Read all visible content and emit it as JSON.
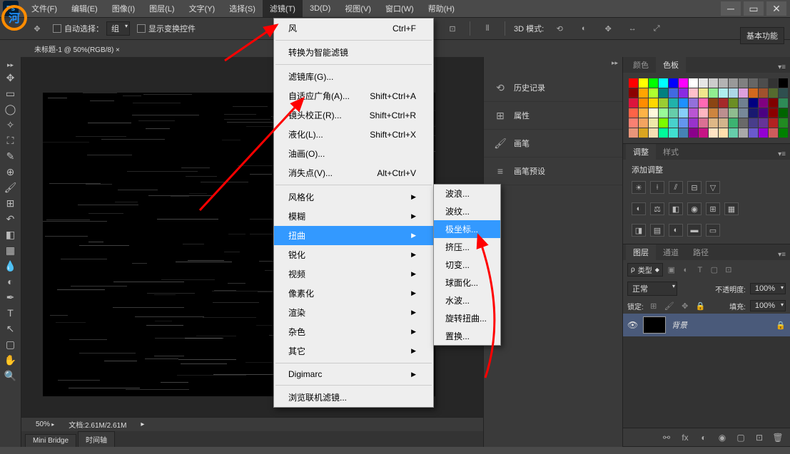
{
  "menubar": [
    "文件(F)",
    "编辑(E)",
    "图像(I)",
    "图层(L)",
    "文字(Y)",
    "选择(S)",
    "滤镜(T)",
    "3D(D)",
    "视图(V)",
    "窗口(W)",
    "帮助(H)"
  ],
  "optionbar": {
    "auto_select": "自动选择：",
    "auto_select_value": "组",
    "show_transform": "显示变换控件",
    "mode_3d": "3D 模式:"
  },
  "top_right_button": "基本功能",
  "doc_tab": "未标题-1 @ 50%(RGB/8) ×",
  "status": {
    "zoom": "50%",
    "doc": "文档:2.61M/2.61M"
  },
  "bottom_tabs": [
    "Mini Bridge",
    "时间轴"
  ],
  "filter_menu": {
    "items": [
      {
        "label": "风",
        "shortcut": "Ctrl+F"
      },
      {
        "sep": true
      },
      {
        "label": "转换为智能滤镜"
      },
      {
        "sep": true
      },
      {
        "label": "滤镜库(G)..."
      },
      {
        "label": "自适应广角(A)...",
        "shortcut": "Shift+Ctrl+A"
      },
      {
        "label": "镜头校正(R)...",
        "shortcut": "Shift+Ctrl+R"
      },
      {
        "label": "液化(L)...",
        "shortcut": "Shift+Ctrl+X"
      },
      {
        "label": "油画(O)..."
      },
      {
        "label": "消失点(V)...",
        "shortcut": "Alt+Ctrl+V"
      },
      {
        "sep": true
      },
      {
        "label": "风格化",
        "sub": true
      },
      {
        "label": "模糊",
        "sub": true
      },
      {
        "label": "扭曲",
        "sub": true,
        "hl": true
      },
      {
        "label": "锐化",
        "sub": true
      },
      {
        "label": "视频",
        "sub": true
      },
      {
        "label": "像素化",
        "sub": true
      },
      {
        "label": "渲染",
        "sub": true
      },
      {
        "label": "杂色",
        "sub": true
      },
      {
        "label": "其它",
        "sub": true
      },
      {
        "sep": true
      },
      {
        "label": "Digimarc",
        "sub": true
      },
      {
        "sep": true
      },
      {
        "label": "浏览联机滤镜..."
      }
    ]
  },
  "sub_menu": [
    "波浪...",
    "波纹...",
    "极坐标...",
    "挤压...",
    "切变...",
    "球面化...",
    "水波...",
    "旋转扭曲...",
    "置换..."
  ],
  "sub_menu_hl_index": 2,
  "mid_panels": [
    "历史记录",
    "属性",
    "画笔",
    "画笔预设"
  ],
  "swatch_tabs": [
    "颜色",
    "色板"
  ],
  "adjust_tabs": [
    "调整",
    "样式"
  ],
  "adjust_label": "添加调整",
  "layers_tabs": [
    "图层",
    "通道",
    "路径"
  ],
  "layers": {
    "kind": "类型",
    "blend": "正常",
    "opacity_label": "不透明度:",
    "opacity_value": "100%",
    "lock_label": "锁定:",
    "fill_label": "填充:",
    "fill_value": "100%",
    "bg_layer": "背景"
  },
  "swatch_colors": [
    "#ff0000",
    "#ffff00",
    "#00ff00",
    "#00ffff",
    "#0000ff",
    "#ff00ff",
    "#ffffff",
    "#e6e6e6",
    "#cccccc",
    "#b3b3b3",
    "#999999",
    "#808080",
    "#666666",
    "#4d4d4d",
    "#333333",
    "#000000",
    "#8b0000",
    "#ffa500",
    "#adff2f",
    "#008080",
    "#4169e1",
    "#8a2be2",
    "#ffc0cb",
    "#f0e68c",
    "#90ee90",
    "#afeeee",
    "#add8e6",
    "#dda0dd",
    "#d2691e",
    "#a0522d",
    "#556b2f",
    "#2f4f4f",
    "#dc143c",
    "#ff8c00",
    "#ffd700",
    "#9acd32",
    "#20b2aa",
    "#1e90ff",
    "#9370db",
    "#ff69b4",
    "#8b4513",
    "#a52a2a",
    "#6b8e23",
    "#708090",
    "#000080",
    "#800080",
    "#800000",
    "#2e8b57",
    "#ff6347",
    "#ffb347",
    "#fff8dc",
    "#98fb98",
    "#66cdaa",
    "#87cefa",
    "#ba55d3",
    "#ffb6c1",
    "#cd853f",
    "#bc8f8f",
    "#8fbc8f",
    "#778899",
    "#191970",
    "#4b0082",
    "#8b0000",
    "#006400",
    "#fa8072",
    "#f4a460",
    "#eee8aa",
    "#7cfc00",
    "#48d1cc",
    "#6495ed",
    "#9932cc",
    "#db7093",
    "#deb887",
    "#d2b48c",
    "#3cb371",
    "#696969",
    "#483d8b",
    "#663399",
    "#b22222",
    "#228b22",
    "#e9967a",
    "#daa520",
    "#f5deb3",
    "#00fa9a",
    "#40e0d0",
    "#4682b4",
    "#8b008b",
    "#c71585",
    "#ffe4c4",
    "#ffdead",
    "#66cdaa",
    "#a9a9a9",
    "#6a5acd",
    "#9400d3",
    "#cd5c5c",
    "#008000"
  ]
}
